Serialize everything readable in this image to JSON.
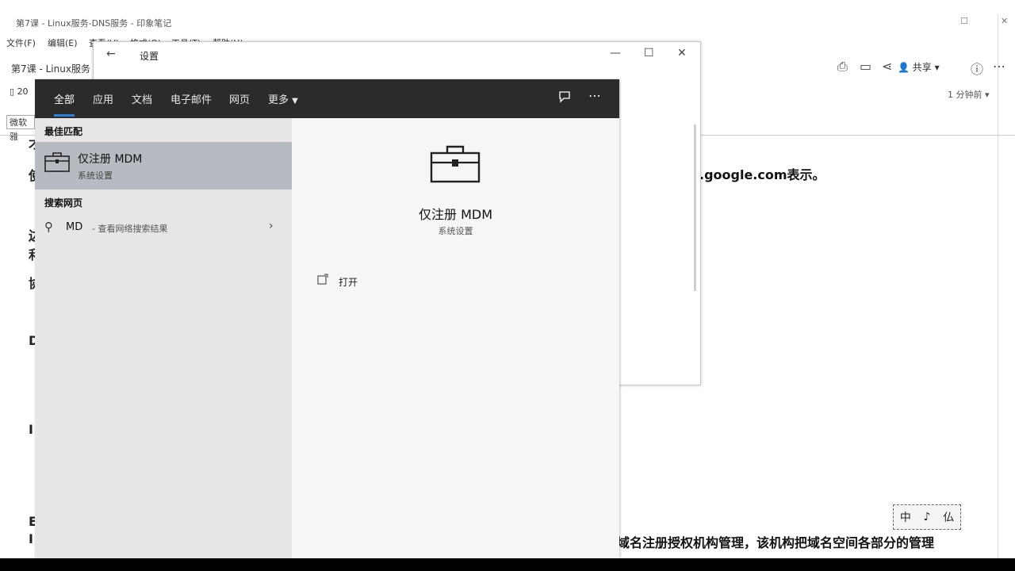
{
  "background_app": {
    "window_title": "第7课 - Linux服务-DNS服务 - 印象笔记",
    "menu": [
      "文件(F)",
      "编辑(E)",
      "查看(V)",
      "格式(O)",
      "工具(T)",
      "帮助(H)"
    ],
    "breadcrumb": "第7课 - Linux服务",
    "row3_text": "20",
    "share_label": "共享",
    "read_time": "1 分钟前",
    "input_value": "微软雅",
    "content_google": ".google.com表示。",
    "content_bottom": "域名注册授权机构管理，该机构把域名空间各部分的管理",
    "left_edge_chars": [
      "才",
      "使",
      "边",
      "利",
      "协",
      "D",
      "I",
      "E",
      "I"
    ],
    "ime_chars": [
      "中",
      "♪",
      "仏"
    ]
  },
  "settings_window": {
    "title": "设置",
    "back_icon": "back-arrow-icon"
  },
  "search_flyout": {
    "tabs": [
      "全部",
      "应用",
      "文档",
      "电子邮件",
      "网页",
      "更多"
    ],
    "more_dropdown_icon": "chevron-down-icon",
    "feedback_icon": "feedback-icon",
    "more_options_icon": "ellipsis-icon",
    "best_match_heading": "最佳匹配",
    "best_match": {
      "name": "仅注册 MDM",
      "subtitle": "系统设置",
      "icon": "briefcase-icon"
    },
    "web_heading": "搜索网页",
    "web_result": {
      "query": "MD",
      "hint": "- 查看网络搜索结果"
    },
    "preview": {
      "name": "仅注册 MDM",
      "subtitle": "系统设置",
      "actions": [
        {
          "label": "打开",
          "icon": "open-icon"
        }
      ]
    }
  }
}
